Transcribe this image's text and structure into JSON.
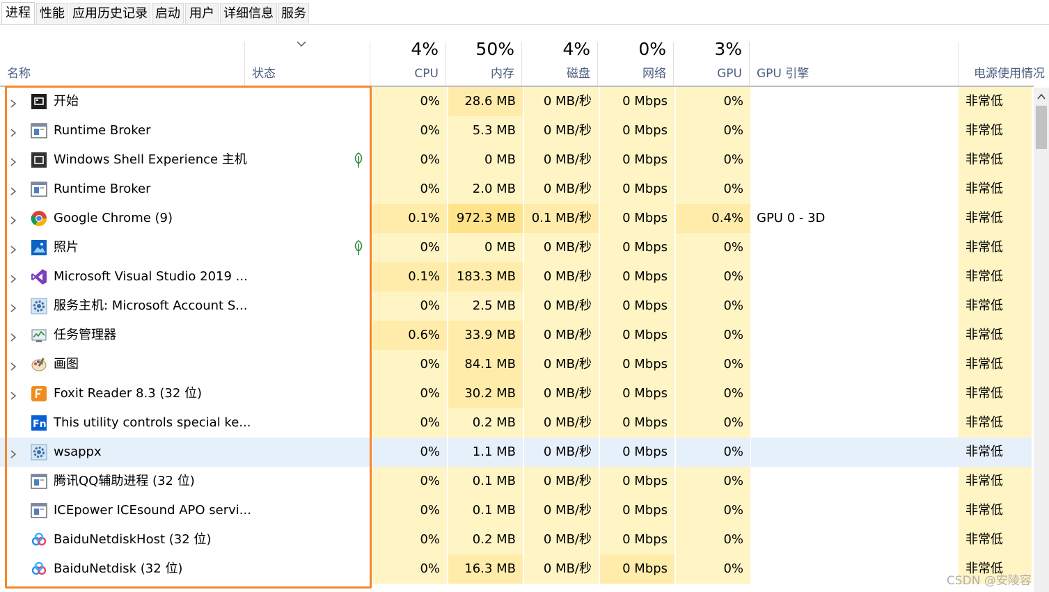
{
  "tabs": [
    {
      "label": "进程",
      "active": true
    },
    {
      "label": "性能"
    },
    {
      "label": "应用历史记录"
    },
    {
      "label": "启动"
    },
    {
      "label": "用户"
    },
    {
      "label": "详细信息"
    },
    {
      "label": "服务"
    }
  ],
  "columns": {
    "name": "名称",
    "status": "状态",
    "cpu": {
      "pct": "4%",
      "label": "CPU"
    },
    "mem": {
      "pct": "50%",
      "label": "内存"
    },
    "disk": {
      "pct": "4%",
      "label": "磁盘"
    },
    "net": {
      "pct": "0%",
      "label": "网络"
    },
    "gpu": {
      "pct": "3%",
      "label": "GPU"
    },
    "gpu_engine": "GPU 引擎",
    "power": "电源使用情况"
  },
  "colors": {
    "heat_light": "#fff4c4",
    "heat_mid": "#ffecaa",
    "heat_strong": "#ffe38a",
    "highlight": "#f4862b",
    "selected": "#e6f0fb"
  },
  "rows": [
    {
      "name": "开始",
      "icon": "start-icon",
      "expand": true,
      "leaf": false,
      "cpu": "0%",
      "mem": "28.6 MB",
      "disk": "0 MB/秒",
      "net": "0 Mbps",
      "gpu": "0%",
      "engine": "",
      "power": "非常低",
      "memheat": 2
    },
    {
      "name": "Runtime Broker",
      "icon": "app-window-icon",
      "expand": true,
      "leaf": false,
      "cpu": "0%",
      "mem": "5.3 MB",
      "disk": "0 MB/秒",
      "net": "0 Mbps",
      "gpu": "0%",
      "engine": "",
      "power": "非常低",
      "memheat": 1
    },
    {
      "name": "Windows Shell Experience 主机",
      "icon": "shell-icon",
      "expand": true,
      "leaf": true,
      "cpu": "0%",
      "mem": "0 MB",
      "disk": "0 MB/秒",
      "net": "0 Mbps",
      "gpu": "0%",
      "engine": "",
      "power": "非常低",
      "memheat": 0
    },
    {
      "name": "Runtime Broker",
      "icon": "app-window-icon",
      "expand": true,
      "leaf": false,
      "cpu": "0%",
      "mem": "2.0 MB",
      "disk": "0 MB/秒",
      "net": "0 Mbps",
      "gpu": "0%",
      "engine": "",
      "power": "非常低",
      "memheat": 1
    },
    {
      "name": "Google Chrome (9)",
      "icon": "chrome-icon",
      "expand": true,
      "leaf": false,
      "cpu": "0.1%",
      "mem": "972.3 MB",
      "disk": "0.1 MB/秒",
      "net": "0 Mbps",
      "gpu": "0.4%",
      "engine": "GPU 0 - 3D",
      "power": "非常低",
      "memheat": 3
    },
    {
      "name": "照片",
      "icon": "photos-icon",
      "expand": true,
      "leaf": true,
      "cpu": "0%",
      "mem": "0 MB",
      "disk": "0 MB/秒",
      "net": "0 Mbps",
      "gpu": "0%",
      "engine": "",
      "power": "非常低",
      "memheat": 0
    },
    {
      "name": "Microsoft Visual Studio 2019 ...",
      "icon": "visual-studio-icon",
      "expand": true,
      "leaf": false,
      "cpu": "0.1%",
      "mem": "183.3 MB",
      "disk": "0 MB/秒",
      "net": "0 Mbps",
      "gpu": "0%",
      "engine": "",
      "power": "非常低",
      "memheat": 2
    },
    {
      "name": "服务主机: Microsoft Account S...",
      "icon": "gear-icon",
      "expand": true,
      "leaf": false,
      "cpu": "0%",
      "mem": "2.5 MB",
      "disk": "0 MB/秒",
      "net": "0 Mbps",
      "gpu": "0%",
      "engine": "",
      "power": "非常低",
      "memheat": 1
    },
    {
      "name": "任务管理器",
      "icon": "task-manager-icon",
      "expand": true,
      "leaf": false,
      "cpu": "0.6%",
      "mem": "33.9 MB",
      "disk": "0 MB/秒",
      "net": "0 Mbps",
      "gpu": "0%",
      "engine": "",
      "power": "非常低",
      "memheat": 2
    },
    {
      "name": "画图",
      "icon": "paint-icon",
      "expand": true,
      "leaf": false,
      "cpu": "0%",
      "mem": "84.1 MB",
      "disk": "0 MB/秒",
      "net": "0 Mbps",
      "gpu": "0%",
      "engine": "",
      "power": "非常低",
      "memheat": 2
    },
    {
      "name": "Foxit Reader 8.3 (32 位)",
      "icon": "foxit-icon",
      "expand": true,
      "leaf": false,
      "cpu": "0%",
      "mem": "30.2 MB",
      "disk": "0 MB/秒",
      "net": "0 Mbps",
      "gpu": "0%",
      "engine": "",
      "power": "非常低",
      "memheat": 2
    },
    {
      "name": "This utility controls special ke...",
      "icon": "fn-key-icon",
      "expand": false,
      "leaf": false,
      "cpu": "0%",
      "mem": "0.2 MB",
      "disk": "0 MB/秒",
      "net": "0 Mbps",
      "gpu": "0%",
      "engine": "",
      "power": "非常低",
      "memheat": 1
    },
    {
      "name": "wsappx",
      "icon": "gear-icon",
      "expand": true,
      "leaf": false,
      "cpu": "0%",
      "mem": "1.1 MB",
      "disk": "0 MB/秒",
      "net": "0 Mbps",
      "gpu": "0%",
      "engine": "",
      "power": "非常低",
      "memheat": 1,
      "selected": true
    },
    {
      "name": "腾讯QQ辅助进程 (32 位)",
      "icon": "app-window-icon",
      "expand": false,
      "leaf": false,
      "cpu": "0%",
      "mem": "0.1 MB",
      "disk": "0 MB/秒",
      "net": "0 Mbps",
      "gpu": "0%",
      "engine": "",
      "power": "非常低",
      "memheat": 1
    },
    {
      "name": "ICEpower ICEsound APO servi...",
      "icon": "app-window-icon",
      "expand": false,
      "leaf": false,
      "cpu": "0%",
      "mem": "0.1 MB",
      "disk": "0 MB/秒",
      "net": "0 Mbps",
      "gpu": "0%",
      "engine": "",
      "power": "非常低",
      "memheat": 1
    },
    {
      "name": "BaiduNetdiskHost (32 位)",
      "icon": "baidu-netdisk-icon",
      "expand": false,
      "leaf": false,
      "cpu": "0%",
      "mem": "0.2 MB",
      "disk": "0 MB/秒",
      "net": "0 Mbps",
      "gpu": "0%",
      "engine": "",
      "power": "非常低",
      "memheat": 1
    },
    {
      "name": "BaiduNetdisk (32 位)",
      "icon": "baidu-netdisk-icon",
      "expand": false,
      "leaf": false,
      "cpu": "0%",
      "mem": "16.3 MB",
      "disk": "0 MB/秒",
      "net": "0 Mbps",
      "gpu": "0%",
      "engine": "",
      "power": "非常低",
      "memheat": 2,
      "netheat": true
    }
  ],
  "watermark": "CSDN @安陵容"
}
